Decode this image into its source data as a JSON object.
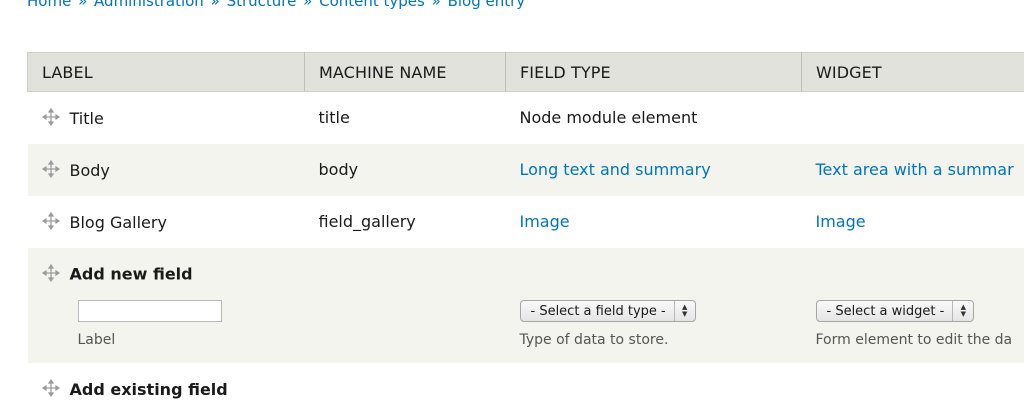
{
  "breadcrumb": {
    "items": [
      "Home",
      "Administration",
      "Structure",
      "Content types",
      "Blog entry"
    ],
    "separator": "»"
  },
  "table": {
    "headers": [
      "LABEL",
      "MACHINE NAME",
      "FIELD TYPE",
      "WIDGET"
    ],
    "rows": [
      {
        "label": "Title",
        "machine_name": "title",
        "field_type": "Node module element",
        "widget": ""
      },
      {
        "label": "Body",
        "machine_name": "body",
        "field_type": "Long text and summary",
        "widget": "Text area with a summar"
      },
      {
        "label": "Blog Gallery",
        "machine_name": "field_gallery",
        "field_type": "Image",
        "widget": "Image"
      }
    ]
  },
  "add_new": {
    "title": "Add new field",
    "label_value": "",
    "label_desc": "Label",
    "field_type_select": "- Select a field type -",
    "field_type_desc": "Type of data to store.",
    "widget_select": "- Select a widget -",
    "widget_desc": "Form element to edit the da"
  },
  "add_existing": {
    "title": "Add existing field"
  },
  "colors": {
    "link": "#0074bd",
    "header_bg": "#e1e2dc",
    "even_row_bg": "#f3f4ee"
  },
  "icons": {
    "drag_handle": "drag-handle-icon"
  }
}
